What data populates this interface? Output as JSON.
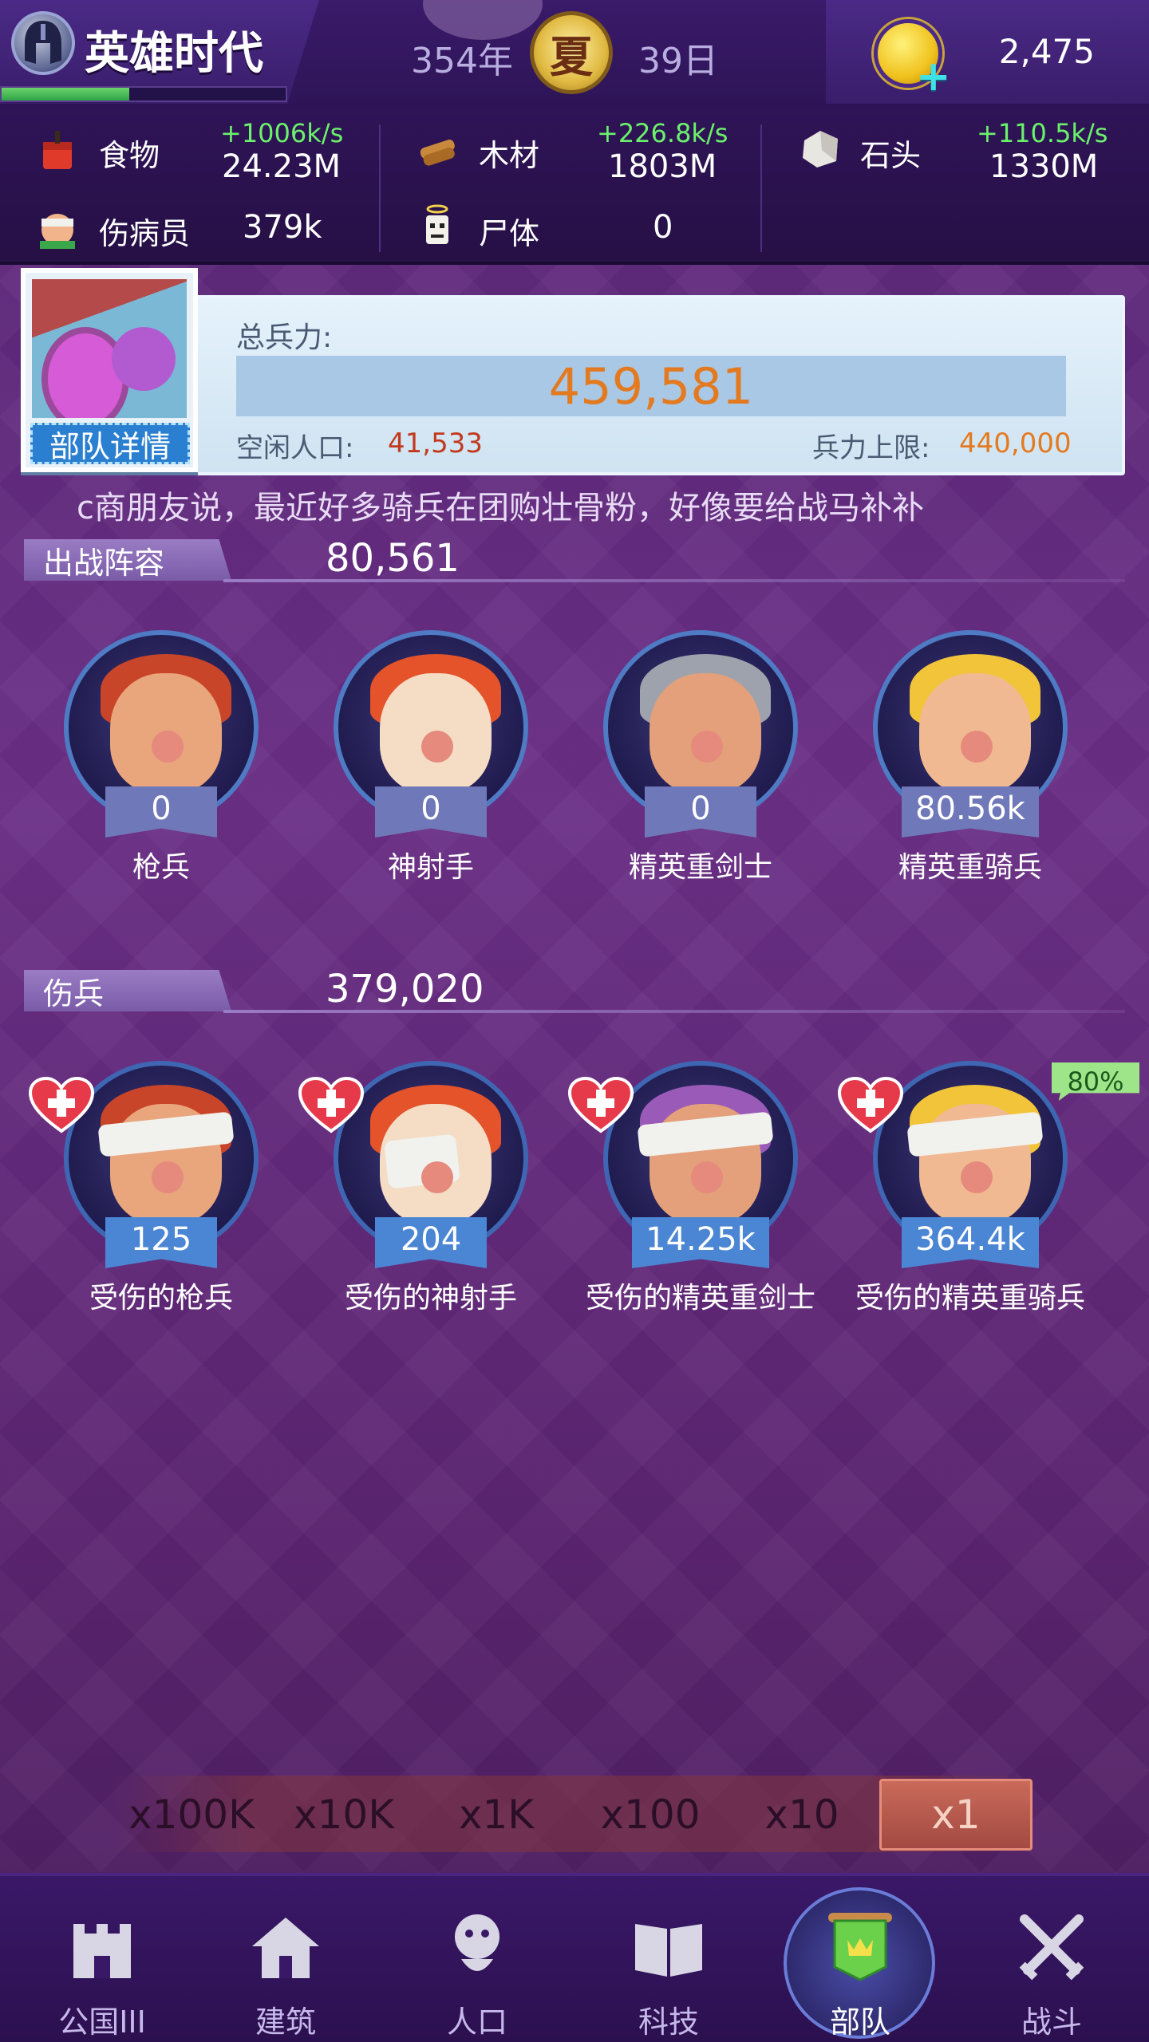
{
  "header": {
    "title": "英雄时代",
    "year": "354年",
    "season": "夏",
    "day": "39日",
    "gold": "2,475",
    "xp_progress": 0.45
  },
  "resources": [
    {
      "name": "food",
      "label": "食物",
      "rate": "+1006k/s",
      "amount": "24.23M"
    },
    {
      "name": "wood",
      "label": "木材",
      "rate": "+226.8k/s",
      "amount": "1803M"
    },
    {
      "name": "stone",
      "label": "石头",
      "rate": "+110.5k/s",
      "amount": "1330M"
    },
    {
      "name": "wounded",
      "label": "伤病员",
      "rate": "",
      "amount": "379k"
    },
    {
      "name": "corpse",
      "label": "尸体",
      "rate": "",
      "amount": "0"
    }
  ],
  "summary": {
    "portrait_label": "部队详情",
    "total_label": "总兵力:",
    "total_value": "459,581",
    "idle_label": "空闲人口:",
    "idle_value": "41,533",
    "cap_label": "兵力上限:",
    "cap_value": "440,000"
  },
  "marquee": "c商朋友说，最近好多骑兵在团购壮骨粉，好像要给战马补补",
  "active_section": {
    "label": "出战阵容",
    "value": "80,561",
    "units": [
      {
        "name": "枪兵",
        "count": "0"
      },
      {
        "name": "神射手",
        "count": "0"
      },
      {
        "name": "精英重剑士",
        "count": "0"
      },
      {
        "name": "精英重骑兵",
        "count": "80.56k"
      }
    ]
  },
  "wounded_section": {
    "label": "伤兵",
    "value": "379,020",
    "units": [
      {
        "name": "受伤的枪兵",
        "count": "125"
      },
      {
        "name": "受伤的神射手",
        "count": "204"
      },
      {
        "name": "受伤的精英重剑士",
        "count": "14.25k"
      },
      {
        "name": "受伤的精英重骑兵",
        "count": "364.4k",
        "badge": "80%"
      }
    ]
  },
  "multipliers": [
    "x100K",
    "x10K",
    "x1K",
    "x100",
    "x10",
    "x1"
  ],
  "multiplier_active": "x1",
  "nav": [
    {
      "label": "公国III",
      "icon": "castle-icon"
    },
    {
      "label": "建筑",
      "icon": "house-icon"
    },
    {
      "label": "人口",
      "icon": "person-icon"
    },
    {
      "label": "科技",
      "icon": "book-icon"
    },
    {
      "label": "部队",
      "icon": "banner-icon",
      "active": true
    },
    {
      "label": "战斗",
      "icon": "crossed-swords-icon"
    }
  ],
  "colors": {
    "accent_orange": "#e47a20",
    "rate_green": "#6bf26b",
    "idle_red": "#c23a1e",
    "background_purple": "#6b2f86"
  }
}
